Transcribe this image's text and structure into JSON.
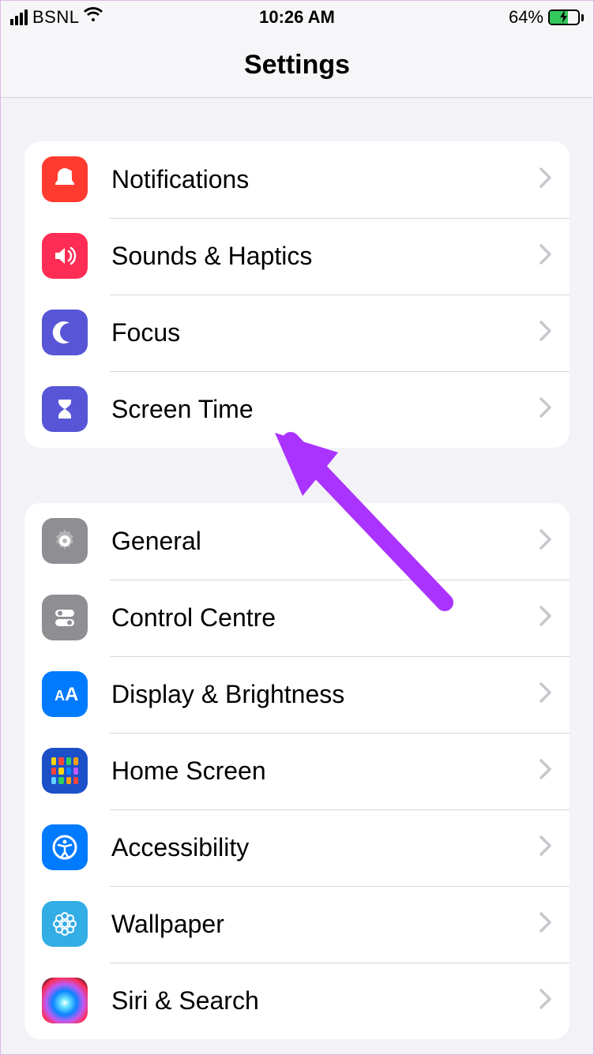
{
  "status": {
    "carrier": "BSNL",
    "time": "10:26 AM",
    "battery_text": "64%",
    "battery_level": 64
  },
  "nav": {
    "title": "Settings"
  },
  "groups": [
    {
      "rows": [
        {
          "id": "notifications",
          "label": "Notifications",
          "icon": "bell-icon",
          "bg": "bg-red"
        },
        {
          "id": "sounds",
          "label": "Sounds & Haptics",
          "icon": "speaker-icon",
          "bg": "bg-pink"
        },
        {
          "id": "focus",
          "label": "Focus",
          "icon": "moon-icon",
          "bg": "bg-indigo"
        },
        {
          "id": "screentime",
          "label": "Screen Time",
          "icon": "hourglass-icon",
          "bg": "bg-indigo"
        }
      ]
    },
    {
      "rows": [
        {
          "id": "general",
          "label": "General",
          "icon": "gear-icon",
          "bg": "bg-gray"
        },
        {
          "id": "controlcentre",
          "label": "Control Centre",
          "icon": "toggles-icon",
          "bg": "bg-gray"
        },
        {
          "id": "display",
          "label": "Display & Brightness",
          "icon": "aa-icon",
          "bg": "bg-blue"
        },
        {
          "id": "homescreen",
          "label": "Home Screen",
          "icon": "grid-icon",
          "bg": "bg-navy"
        },
        {
          "id": "accessibility",
          "label": "Accessibility",
          "icon": "person-circle-icon",
          "bg": "bg-blue"
        },
        {
          "id": "wallpaper",
          "label": "Wallpaper",
          "icon": "flower-icon",
          "bg": "bg-lblue"
        },
        {
          "id": "siri",
          "label": "Siri & Search",
          "icon": "siri-icon",
          "bg": "bg-dark"
        }
      ]
    }
  ],
  "annotation": {
    "target": "screentime",
    "color": "#aa33ff"
  }
}
